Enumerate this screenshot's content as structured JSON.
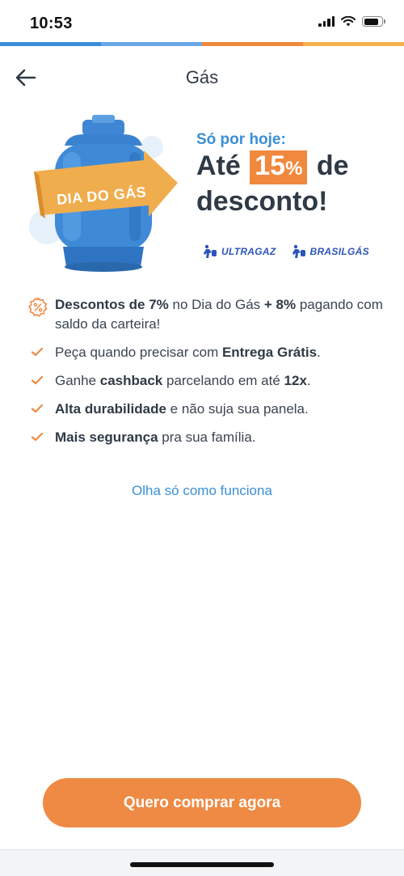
{
  "status": {
    "time": "10:53"
  },
  "stripe_colors": [
    "#3a8fd6",
    "#6aa8e8",
    "#f08a3e",
    "#f3b24a"
  ],
  "header": {
    "title": "Gás"
  },
  "hero": {
    "banner_label": "DIA DO GÁS",
    "today": "Só por hoje:",
    "line1_before": "Até",
    "discount_number": "15",
    "discount_percent": "%",
    "line1_after": "de",
    "line2": "desconto!",
    "brands": [
      "ULTRAGAZ",
      "BRASILGÁS"
    ]
  },
  "features": [
    {
      "b1": "Descontos de 7%",
      "t1": " no Dia do Gás ",
      "b2": "+ 8%",
      "t2": " pagando com saldo da carteira!"
    },
    {
      "t1": "Peça quando precisar com ",
      "b1": "Entrega Grátis",
      "t2": "."
    },
    {
      "t1": "Ganhe ",
      "b1": "cashback",
      "t2": " parcelando em até ",
      "b2": "12x",
      "t3": "."
    },
    {
      "b1": "Alta durabilidade",
      "t1": " e não suja sua panela."
    },
    {
      "b1": "Mais segurança",
      "t1": " pra sua família."
    }
  ],
  "how_link": "Olha só como funciona",
  "cta": {
    "label": "Quero comprar agora"
  },
  "colors": {
    "accent": "#ee8a44",
    "link": "#3a8fd6",
    "text": "#2f3a46"
  }
}
